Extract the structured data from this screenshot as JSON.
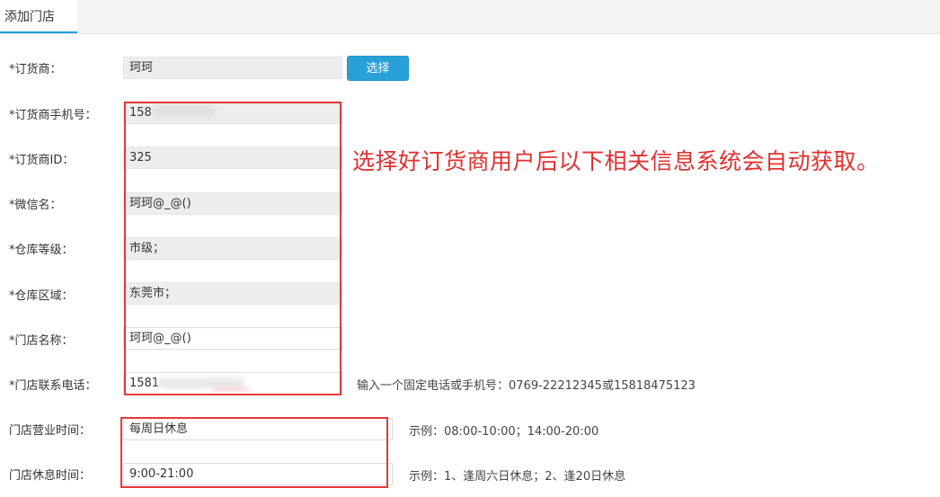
{
  "tab": {
    "label": "添加门店"
  },
  "form": {
    "supplier": {
      "label": "*订货商：",
      "value": "珂珂",
      "button": "选择"
    },
    "phone": {
      "label": "*订货商手机号：",
      "value": "158"
    },
    "supplier_id": {
      "label": "*订货商ID：",
      "value": "325"
    },
    "wechat": {
      "label": "*微信名：",
      "value": "珂珂@_@()"
    },
    "warehouse_level": {
      "label": "*仓库等级：",
      "value": "市级；"
    },
    "warehouse_area": {
      "label": "*仓库区域：",
      "value": "东莞市；"
    },
    "store_name": {
      "label": "*门店名称：",
      "value": "珂珂@_@()"
    },
    "store_phone": {
      "label": "*门店联系电话：",
      "value": "1581",
      "hint": "输入一个固定电话或手机号：0769-22212345或15818475123"
    },
    "business_hours": {
      "label": "门店营业时间：",
      "value": "每周日休息",
      "hint": "示例：08:00-10:00；14:00-20:00"
    },
    "rest_time": {
      "label": "门店休息时间：",
      "value": "9:00-21:00",
      "hint": "示例：1、逢周六日休息；2、逢20日休息"
    }
  },
  "annotation": {
    "text": "选择好订货商用户后以下相关信息系统会自动获取。"
  },
  "colors": {
    "accent": "#2aa0d8",
    "annotation_red": "#e23030",
    "readonly_bg": "#ededed"
  }
}
